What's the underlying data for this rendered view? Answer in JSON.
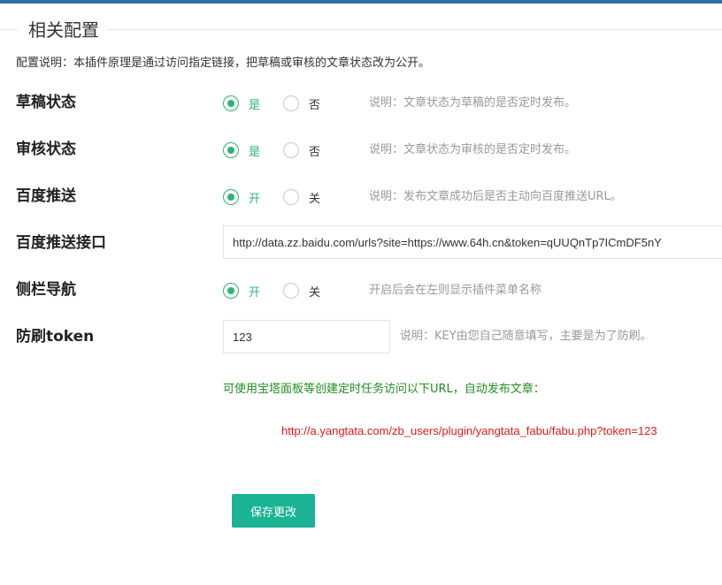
{
  "fieldset": {
    "legend": "相关配置",
    "description": "配置说明：本插件原理是通过访问指定链接，把草稿或审核的文章状态改为公开。"
  },
  "rows": {
    "draft_status": {
      "label": "草稿状态",
      "options": [
        "是",
        "否"
      ],
      "selected": 0,
      "hint": "说明：文章状态为草稿的是否定时发布。"
    },
    "review_status": {
      "label": "审核状态",
      "options": [
        "是",
        "否"
      ],
      "selected": 0,
      "hint": "说明：文章状态为审核的是否定时发布。"
    },
    "baidu_push": {
      "label": "百度推送",
      "options": [
        "开",
        "关"
      ],
      "selected": 0,
      "hint": "说明：发布文章成功后是否主动向百度推送URL。"
    },
    "baidu_api": {
      "label": "百度推送接口",
      "value": "http://data.zz.baidu.com/urls?site=https://www.64h.cn&token=qUUQnTp7ICmDF5nY"
    },
    "sidebar_nav": {
      "label": "侧栏导航",
      "options": [
        "开",
        "关"
      ],
      "selected": 0,
      "hint": "开启后会在左则显示插件菜单名称"
    },
    "anti_spam_token": {
      "label": "防刷token",
      "value": "123",
      "hint": "说明：KEY由您自己随意填写，主要是为了防刷。"
    }
  },
  "cron_note": "可使用宝塔面板等创建定时任务访问以下URL，自动发布文章：",
  "cron_url": "http://a.yangtata.com/zb_users/plugin/yangtata_fabu/fabu.php?token=123",
  "save_button": "保存更改",
  "colors": {
    "accent_green": "#2bb673",
    "button_teal": "#1ab394",
    "note_green": "#1f8f1f",
    "link_red": "#e01b1b",
    "top_bar": "#2f6ea5"
  }
}
